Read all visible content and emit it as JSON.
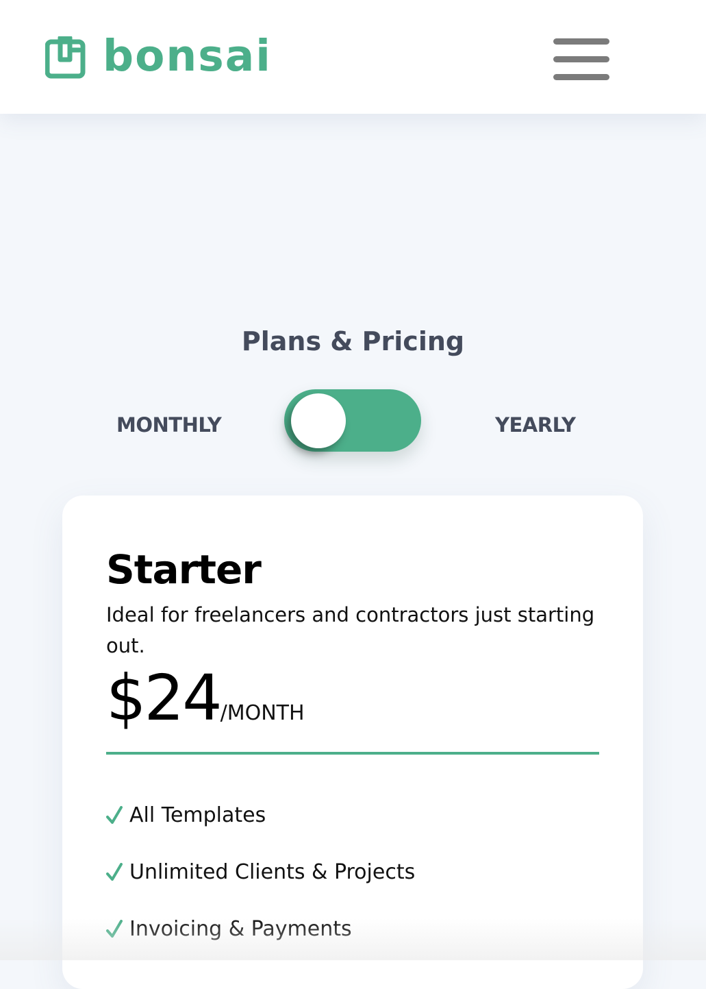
{
  "brand": {
    "name": "bonsai",
    "logo_icon": "bonsai-logo-icon",
    "color": "#4caf8a"
  },
  "header": {
    "menu_icon": "hamburger-menu-icon",
    "menu_color": "#7b7b7b"
  },
  "pricing": {
    "title": "Plans & Pricing",
    "toggle": {
      "left_label": "MONTHLY",
      "right_label": "YEARLY",
      "selected": "MONTHLY",
      "track_color": "#4caf8a"
    }
  },
  "plan": {
    "name": "Starter",
    "description": "Ideal for freelancers and contractors just starting out.",
    "price": "$24",
    "price_unit": "/MONTH",
    "accent_color": "#4caf8a",
    "features": [
      {
        "label": "All Templates",
        "icon": "check-icon"
      },
      {
        "label": "Unlimited Clients & Projects",
        "icon": "check-icon"
      },
      {
        "label": "Invoicing & Payments",
        "icon": "check-icon"
      }
    ]
  }
}
